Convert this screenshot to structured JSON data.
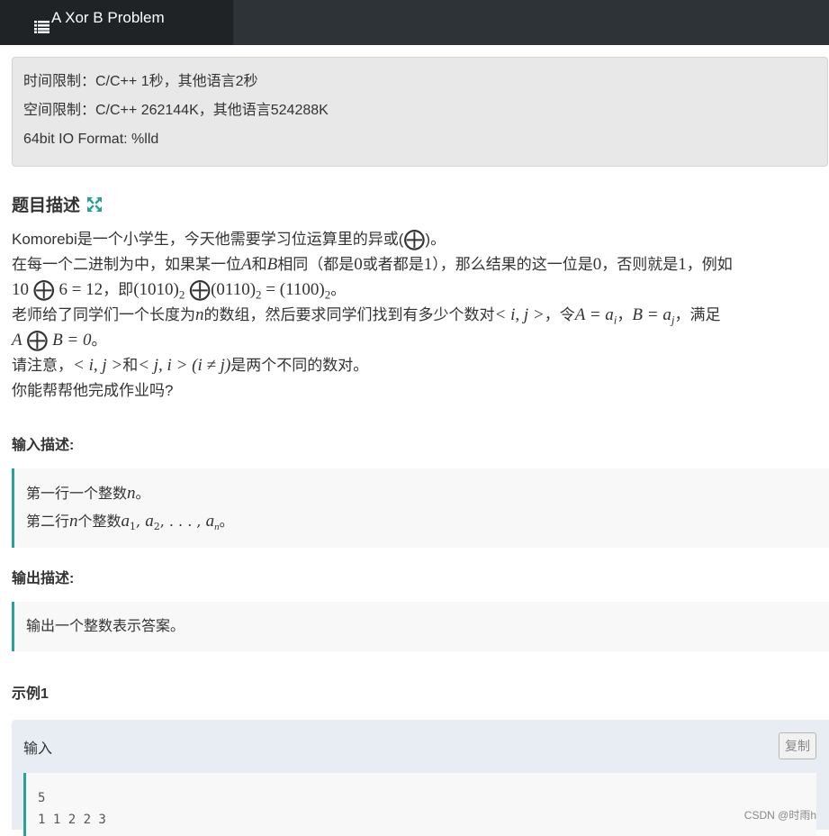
{
  "header": {
    "tab_title": "A Xor B Problem"
  },
  "limits": {
    "time": "时间限制：C/C++ 1秒，其他语言2秒",
    "space": "空间限制：C/C++ 262144K，其他语言524288K",
    "io": "64bit IO Format: %lld"
  },
  "description": {
    "title": "题目描述",
    "l1a": "Komorebi是一个小学生，今天他需要学习位运算里的异或(",
    "l1b": ")。",
    "l2a": "在每一个二进制为中，如果某一位",
    "l2b": "A",
    "l2c": "和",
    "l2d": "B",
    "l2e": "相同（都是",
    "l2f": "0",
    "l2g": "或者都是",
    "l2h": "1",
    "l2i": "），那么结果的这一位是",
    "l2j": "0",
    "l2k": "，否则就是",
    "l2l": "1",
    "l2m": "，例如",
    "l3a": "10",
    "l3b": "6 = 12",
    "l3c": "，即",
    "l3d": "(1010)",
    "l3e": "2",
    "l3f": "(0110)",
    "l3g": "2",
    "l3h": " = (1100)",
    "l3i": "2",
    "l3j": "。",
    "l4a": "老师给了同学们一个长度为",
    "l4b": "n",
    "l4c": "的数组，然后要求同学们找到有多少个数对",
    "l4d": "< i, j >",
    "l4e": "，令",
    "l4f": "A = a",
    "l4g": "i",
    "l4h": "，",
    "l4i": "B = a",
    "l4j": "j",
    "l4k": "，满足",
    "l5a": "A",
    "l5b": "B = 0",
    "l5c": "。",
    "l6a": "请注意，",
    "l6b": "< i, j >",
    "l6c": "和",
    "l6d": "< j, i > (i ≠ j)",
    "l6e": "是两个不同的数对。",
    "l7": "你能帮帮他完成作业吗?",
    "oplus": "⨁"
  },
  "input_desc": {
    "title": "输入描述:",
    "l1a": "第一行一个整数",
    "l1b": "n",
    "l1c": "。",
    "l2a": "第二行",
    "l2b": "n",
    "l2c": "个整数",
    "l2d": "a",
    "l2e": "1",
    "l2f": ", ",
    "l2g": "a",
    "l2h": "2",
    "l2i": ", . . . , ",
    "l2j": "a",
    "l2k": "n",
    "l2l": "。"
  },
  "output_desc": {
    "title": "输出描述:",
    "l1": "输出一个整数表示答案。"
  },
  "example": {
    "title": "示例1",
    "input_label": "输入",
    "copy_label": "复制",
    "line1": "5",
    "line2": "1 1 2 2 3"
  },
  "watermark": "CSDN @时雨h",
  "colors": {
    "topbar": "#2e3337",
    "tab": "#1f2326",
    "accent": "#2aa198"
  }
}
